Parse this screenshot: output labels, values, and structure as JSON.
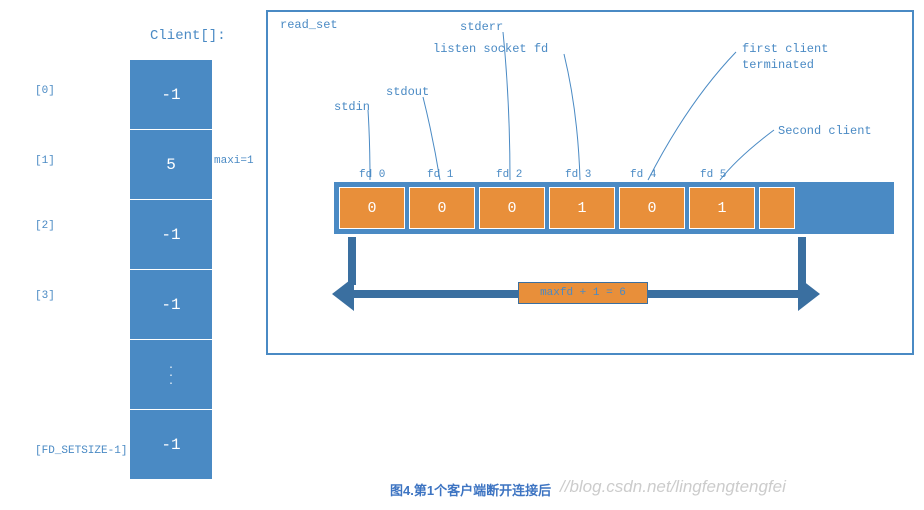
{
  "client_array": {
    "title": "Client[]:",
    "indices": [
      "[0]",
      "[1]",
      "[2]",
      "[3]",
      "[FD_SETSIZE-1]"
    ],
    "values": [
      "-1",
      "5",
      "-1",
      "-1",
      "-1"
    ],
    "dots": ". . .",
    "maxi_label": "maxi=1"
  },
  "read_set": {
    "title": "read_set",
    "labels": {
      "stdin": "stdin",
      "stdout": "stdout",
      "stderr": "stderr",
      "listen": "listen socket fd",
      "first_client_l1": "first client",
      "first_client_l2": "terminated",
      "second_client": "Second client"
    },
    "fd_ticks": [
      "fd 0",
      "fd 1",
      "fd 2",
      "fd 3",
      "fd 4",
      "fd 5"
    ],
    "fd_values": [
      "0",
      "0",
      "0",
      "1",
      "0",
      "1"
    ],
    "range_label": "maxfd + 1 = 6"
  },
  "caption": "图4.第1个客户端断开连接后",
  "watermark": "//blog.csdn.net/lingfengtengfei",
  "chart_data": {
    "type": "table",
    "client_array": {
      "index_labels": [
        "[0]",
        "[1]",
        "[2]",
        "[3]",
        "...",
        "[FD_SETSIZE-1]"
      ],
      "values": [
        -1,
        5,
        -1,
        -1,
        null,
        -1
      ],
      "maxi": 1
    },
    "fd_set": {
      "fds": [
        0,
        1,
        2,
        3,
        4,
        5
      ],
      "bits": [
        0,
        0,
        0,
        1,
        0,
        1
      ],
      "fd_roles": [
        "stdin",
        "stdout",
        "stderr",
        "listen socket fd",
        "first client terminated",
        "Second client"
      ],
      "maxfd_plus_one": 6
    }
  }
}
